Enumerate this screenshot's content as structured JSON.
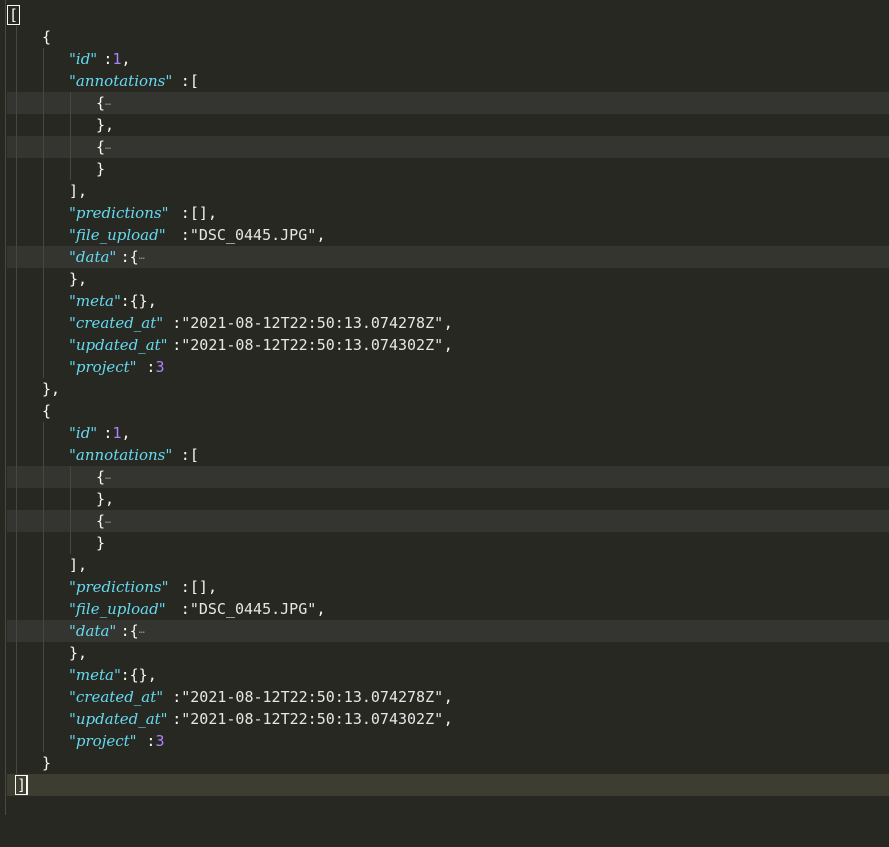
{
  "editor": {
    "theme_colors": {
      "background": "#272822",
      "key": "#66d9ef",
      "number": "#ae81ff",
      "string": "#e6e6e6",
      "punctuation": "#f8f8f2",
      "fold_highlight": "#343530",
      "current_line": "#3e3d32"
    },
    "fold_marker": "…",
    "document": {
      "open_bracket": "[",
      "close_bracket": "]",
      "records": [
        {
          "id_key": "\"id\"",
          "id_value": "1",
          "annotations_key": "\"annotations\"",
          "predictions_key": "\"predictions\"",
          "predictions_value": "[]",
          "file_upload_key": "\"file_upload\"",
          "file_upload_value": "\"DSC_0445.JPG\"",
          "data_key": "\"data\"",
          "meta_key": "\"meta\"",
          "meta_value": "{}",
          "created_at_key": "\"created_at\"",
          "created_at_value": "\"2021-08-12T22:50:13.074278Z\"",
          "updated_at_key": "\"updated_at\"",
          "updated_at_value": "\"2021-08-12T22:50:13.074302Z\"",
          "project_key": "\"project\"",
          "project_value": "3"
        },
        {
          "id_key": "\"id\"",
          "id_value": "1",
          "annotations_key": "\"annotations\"",
          "predictions_key": "\"predictions\"",
          "predictions_value": "[]",
          "file_upload_key": "\"file_upload\"",
          "file_upload_value": "\"DSC_0445.JPG\"",
          "data_key": "\"data\"",
          "meta_key": "\"meta\"",
          "meta_value": "{}",
          "created_at_key": "\"created_at\"",
          "created_at_value": "\"2021-08-12T22:50:13.074278Z\"",
          "updated_at_key": "\"updated_at\"",
          "updated_at_value": "\"2021-08-12T22:50:13.074302Z\"",
          "project_key": "\"project\"",
          "project_value": "3"
        }
      ]
    }
  }
}
